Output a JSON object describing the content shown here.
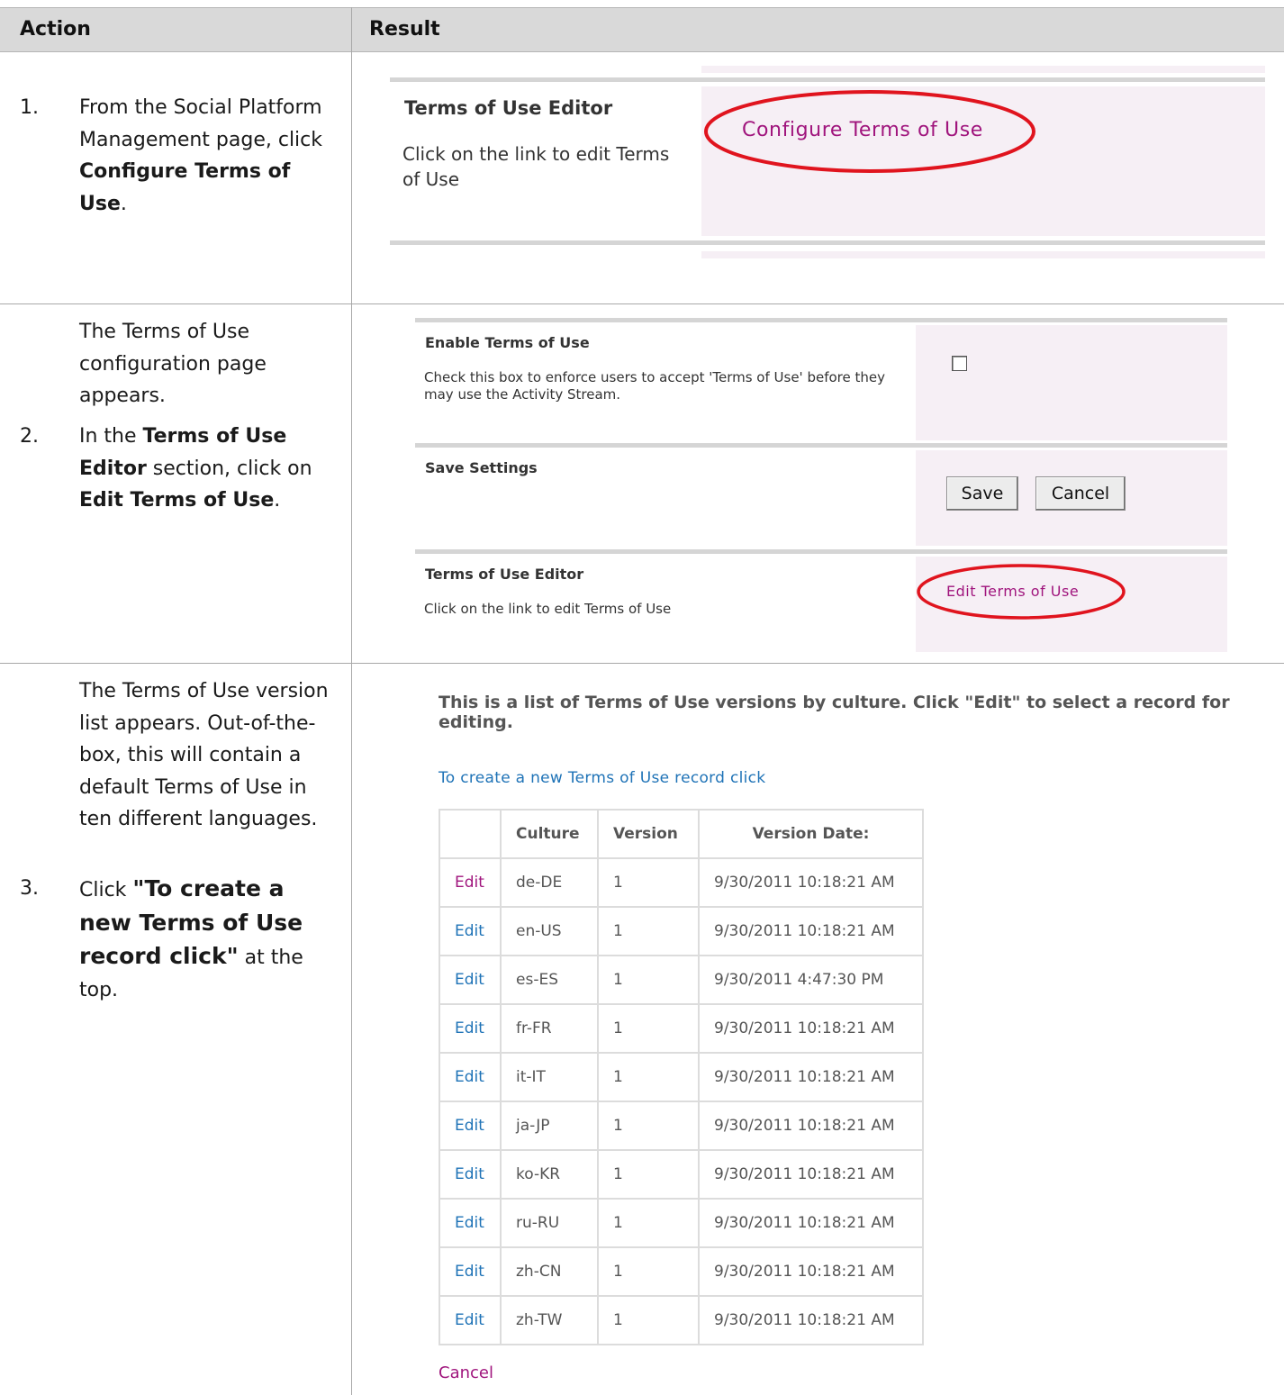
{
  "header": {
    "action": "Action",
    "result": "Result"
  },
  "rows": [
    {
      "num": "1.",
      "segments": [
        {
          "t": "From the Social Platform Management page, click ",
          "b": false
        },
        {
          "t": "Configure Terms of Use",
          "b": true
        },
        {
          "t": ".",
          "b": false
        }
      ]
    },
    {
      "intro": "The Terms of Use configuration page appears.",
      "num": "2.",
      "segments": [
        {
          "t": "In the ",
          "b": false
        },
        {
          "t": "Terms of Use Editor",
          "b": true
        },
        {
          "t": " section, click on ",
          "b": false
        },
        {
          "t": "Edit Terms of Use",
          "b": true
        },
        {
          "t": ".",
          "b": false
        }
      ]
    },
    {
      "intro": "The Terms of Use version list appears. Out-of-the-box, this will contain a default Terms of Use in ten different languages.",
      "num": "3.",
      "segments": [
        {
          "t": "Click ",
          "b": false
        },
        {
          "t": "\"To create a new Terms of Use record click\"",
          "b": true
        },
        {
          "t": " at the top.",
          "b": false
        }
      ]
    }
  ],
  "shot1": {
    "title": "Terms of Use Editor",
    "description": "Click on the link to edit Terms of Use",
    "link": "Configure Terms of Use"
  },
  "shot2": {
    "enable_title": "Enable Terms of Use",
    "enable_desc": "Check this box to enforce users to accept 'Terms of Use' before they may use the Activity Stream.",
    "enable_checked": false,
    "save_title": "Save Settings",
    "save_button": "Save",
    "cancel_button": "Cancel",
    "editor_title": "Terms of Use Editor",
    "editor_desc": "Click on the link to edit Terms of Use",
    "editor_link": "Edit Terms of Use"
  },
  "shot3": {
    "heading": "This is a list of Terms of Use versions by culture. Click \"Edit\" to select a record for editing.",
    "create_link": "To create a new Terms of Use record click",
    "columns": [
      "",
      "Culture",
      "Version",
      "Version Date:"
    ],
    "records": [
      {
        "edit": "Edit",
        "culture": "de-DE",
        "version": "1",
        "date": "9/30/2011 10:18:21 AM"
      },
      {
        "edit": "Edit",
        "culture": "en-US",
        "version": "1",
        "date": "9/30/2011 10:18:21 AM"
      },
      {
        "edit": "Edit",
        "culture": "es-ES",
        "version": "1",
        "date": "9/30/2011 4:47:30 PM"
      },
      {
        "edit": "Edit",
        "culture": "fr-FR",
        "version": "1",
        "date": "9/30/2011 10:18:21 AM"
      },
      {
        "edit": "Edit",
        "culture": "it-IT",
        "version": "1",
        "date": "9/30/2011 10:18:21 AM"
      },
      {
        "edit": "Edit",
        "culture": "ja-JP",
        "version": "1",
        "date": "9/30/2011 10:18:21 AM"
      },
      {
        "edit": "Edit",
        "culture": "ko-KR",
        "version": "1",
        "date": "9/30/2011 10:18:21 AM"
      },
      {
        "edit": "Edit",
        "culture": "ru-RU",
        "version": "1",
        "date": "9/30/2011 10:18:21 AM"
      },
      {
        "edit": "Edit",
        "culture": "zh-CN",
        "version": "1",
        "date": "9/30/2011 10:18:21 AM"
      },
      {
        "edit": "Edit",
        "culture": "zh-TW",
        "version": "1",
        "date": "9/30/2011 10:18:21 AM"
      }
    ],
    "cancel": "Cancel"
  },
  "colors": {
    "link_magenta": "#a0157d",
    "link_blue": "#1f73b7",
    "highlight_ellipse": "#e0141e",
    "panel_pink": "#f6eff5",
    "header_gray": "#d9d9d9"
  }
}
